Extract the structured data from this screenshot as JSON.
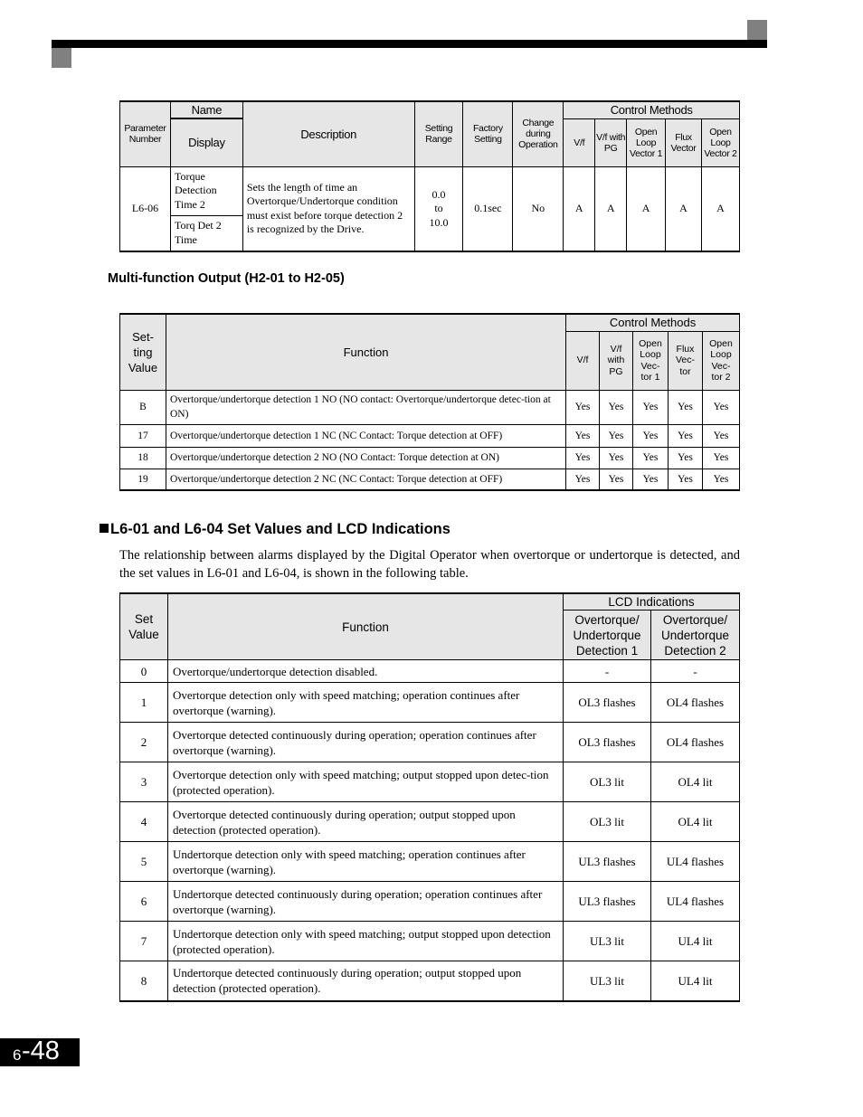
{
  "page": {
    "chapter": "6",
    "number": "-48"
  },
  "param_table": {
    "headers": {
      "parameter_number": "Parameter Number",
      "name": "Name",
      "display": "Display",
      "description": "Description",
      "setting_range": "Setting Range",
      "factory_setting": "Factory Setting",
      "change_during_operation": "Change during Operation",
      "control_methods": "Control Methods",
      "methods": [
        "V/f",
        "V/f with PG",
        "Open Loop Vector 1",
        "Flux Vector",
        "Open Loop Vector 2"
      ]
    },
    "row": {
      "number": "L6-06",
      "name": "Torque Detection Time 2",
      "display": "Torq Det 2 Time",
      "description": "Sets the length of time an Overtorque/Undertorque condition must exist before torque detection 2 is recognized by the Drive.",
      "range_min": "0.0",
      "range_to": "to",
      "range_max": "10.0",
      "factory": "0.1sec",
      "change": "No",
      "methods": [
        "A",
        "A",
        "A",
        "A",
        "A"
      ]
    }
  },
  "multi_function": {
    "heading": "Multi-function Output (H2-01 to H2-05)",
    "headers": {
      "setting_value": "Set-ting Value",
      "function": "Function",
      "control_methods": "Control Methods",
      "methods": [
        "V/f",
        "V/f with PG",
        "Open Loop Vec-tor 1",
        "Flux Vec-tor",
        "Open Loop Vec-tor 2"
      ]
    },
    "rows": [
      {
        "value": "B",
        "function": "Overtorque/undertorque detection 1 NO (NO contact: Overtorque/undertorque detec-tion at ON)",
        "methods": [
          "Yes",
          "Yes",
          "Yes",
          "Yes",
          "Yes"
        ]
      },
      {
        "value": "17",
        "function": "Overtorque/undertorque detection 1 NC (NC Contact: Torque detection at OFF)",
        "methods": [
          "Yes",
          "Yes",
          "Yes",
          "Yes",
          "Yes"
        ]
      },
      {
        "value": "18",
        "function": "Overtorque/undertorque detection 2 NO (NO Contact: Torque detection at ON)",
        "methods": [
          "Yes",
          "Yes",
          "Yes",
          "Yes",
          "Yes"
        ]
      },
      {
        "value": "19",
        "function": "Overtorque/undertorque detection 2 NC (NC Contact: Torque detection at OFF)",
        "methods": [
          "Yes",
          "Yes",
          "Yes",
          "Yes",
          "Yes"
        ]
      }
    ]
  },
  "lcd_section": {
    "heading": "L6-01 and L6-04 Set Values and LCD Indications",
    "paragraph": "The relationship between alarms displayed by the Digital Operator when overtorque or undertorque is detected, and the set values in L6-01 and L6-04, is shown in the following table.",
    "headers": {
      "set_value": "Set Value",
      "function": "Function",
      "lcd_indications": "LCD Indications",
      "detection1": "Overtorque/ Undertorque Detection 1",
      "detection2": "Overtorque/ Undertorque Detection 2"
    },
    "rows": [
      {
        "value": "0",
        "function": "Overtorque/undertorque detection disabled.",
        "d1": "-",
        "d2": "-"
      },
      {
        "value": "1",
        "function": "Overtorque detection only with speed matching; operation continues after overtorque (warning).",
        "d1": "OL3 flashes",
        "d2": "OL4 flashes"
      },
      {
        "value": "2",
        "function": "Overtorque detected continuously during operation; operation continues after overtorque (warning).",
        "d1": "OL3 flashes",
        "d2": "OL4 flashes"
      },
      {
        "value": "3",
        "function": "Overtorque detection only with speed matching; output stopped upon detec-tion (protected operation).",
        "d1": "OL3 lit",
        "d2": "OL4 lit"
      },
      {
        "value": "4",
        "function": "Overtorque detected continuously during operation; output stopped upon detection (protected operation).",
        "d1": "OL3 lit",
        "d2": "OL4 lit"
      },
      {
        "value": "5",
        "function": "Undertorque detection only with speed matching; operation continues after overtorque (warning).",
        "d1": "UL3 flashes",
        "d2": "UL4 flashes"
      },
      {
        "value": "6",
        "function": "Undertorque detected continuously during operation; operation continues after overtorque (warning).",
        "d1": "UL3 flashes",
        "d2": "UL4 flashes"
      },
      {
        "value": "7",
        "function": "Undertorque detection only with speed matching; output stopped upon detection (protected operation).",
        "d1": "UL3 lit",
        "d2": "UL4 lit"
      },
      {
        "value": "8",
        "function": "Undertorque detected continuously during operation; output stopped upon detection (protected operation).",
        "d1": "UL3 lit",
        "d2": "UL4 lit"
      }
    ]
  }
}
